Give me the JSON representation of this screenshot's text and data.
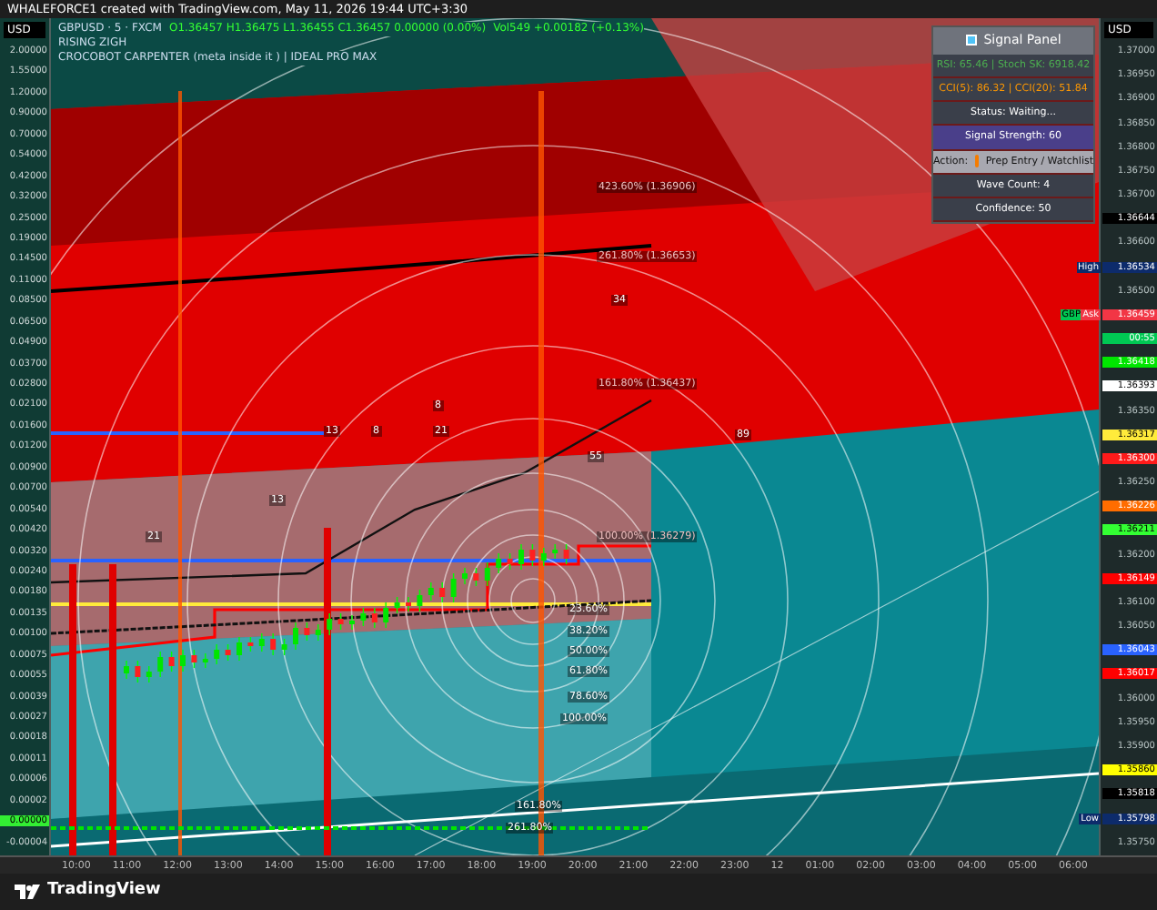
{
  "header": {
    "title": "WHALEFORCE1 created with TradingView.com, May 11, 2026 19:44 UTC+3:30"
  },
  "legend": {
    "symbol": "GBPUSD · 5 · FXCM",
    "ohlc": "O1.36457 H1.36475 L1.36455 C1.36457 0.00000 (0.00%)",
    "volume": "Vol549 +0.00182 (+0.13%)",
    "indicators": [
      "RISING ZIGH",
      "CROCOBOT CARPENTER (meta inside it ) | IDEAL PRO MAX"
    ]
  },
  "left_axis": {
    "currency": "USD",
    "labels": [
      "2.00000",
      "1.55000",
      "1.20000",
      "0.90000",
      "0.70000",
      "0.54000",
      "0.42000",
      "0.32000",
      "0.25000",
      "0.19000",
      "0.14500",
      "0.11000",
      "0.08500",
      "0.06500",
      "0.04900",
      "0.03700",
      "0.02800",
      "0.02100",
      "0.01600",
      "0.01200",
      "0.00900",
      "0.00700",
      "0.00540",
      "0.00420",
      "0.00320",
      "0.00240",
      "0.00180",
      "0.00135",
      "0.00100",
      "0.00075",
      "0.00055",
      "0.00039",
      "0.00027",
      "0.00018",
      "0.00011",
      "0.00006",
      "0.00002"
    ],
    "current": "0.00000",
    "below": [
      "-0.00004"
    ]
  },
  "right_axis": {
    "currency": "USD",
    "labels": [
      {
        "text": "1.37000"
      },
      {
        "text": "1.36950"
      },
      {
        "text": "1.36900"
      },
      {
        "text": "1.36850"
      },
      {
        "text": "1.36800"
      },
      {
        "text": "1.36750"
      },
      {
        "text": "1.36700"
      },
      {
        "text": "1.36644",
        "color": "#000000"
      },
      {
        "text": "1.36600"
      },
      {
        "text": "1.36534",
        "color": "#0d2b6b",
        "tag": "High"
      },
      {
        "text": "1.36500"
      },
      {
        "text": "1.36459",
        "color": "#f23645",
        "tag": "Ask",
        "tag2": "GBP"
      },
      {
        "text": "00:55",
        "color": "#00c853"
      },
      {
        "text": "1.36418",
        "color": "#00e600"
      },
      {
        "text": "1.36393",
        "color": "#ffffff"
      },
      {
        "text": "1.36350"
      },
      {
        "text": "1.36317",
        "color": "#ffeb3b"
      },
      {
        "text": "1.36300",
        "color": "#ff1a1a"
      },
      {
        "text": "1.36250"
      },
      {
        "text": "1.36226",
        "color": "#ff6d00"
      },
      {
        "text": "1.36211",
        "color": "#33ff33"
      },
      {
        "text": "1.36200"
      },
      {
        "text": "1.36149",
        "color": "#ff0000"
      },
      {
        "text": "1.36100"
      },
      {
        "text": "1.36050"
      },
      {
        "text": "1.36043",
        "color": "#2962ff"
      },
      {
        "text": "1.36017",
        "color": "#ff0000"
      },
      {
        "text": "1.36000"
      },
      {
        "text": "1.35950"
      },
      {
        "text": "1.35900"
      },
      {
        "text": "1.35860",
        "color": "#ffff00"
      },
      {
        "text": "1.35818",
        "color": "#000000"
      },
      {
        "text": "1.35798",
        "color": "#0d2b6b",
        "tag": "Low"
      },
      {
        "text": "1.35750"
      }
    ]
  },
  "time_axis": [
    "10:00",
    "11:00",
    "12:00",
    "13:00",
    "14:00",
    "15:00",
    "16:00",
    "17:00",
    "18:00",
    "19:00",
    "20:00",
    "21:00",
    "22:00",
    "23:00",
    "12",
    "01:00",
    "02:00",
    "03:00",
    "04:00",
    "05:00",
    "06:00"
  ],
  "chart_labels": [
    "423.60% (1.36906)",
    "261.80% (1.36653)",
    "34",
    "161.80% (1.36437)",
    "8",
    "13",
    "8",
    "21",
    "89",
    "55",
    "13",
    "21",
    "100.00% (1.36279)",
    "23.60%",
    "38.20%",
    "50.00%",
    "61.80%",
    "78.60%",
    "100.00%",
    "161.80%",
    "261.80%"
  ],
  "signal_panel": {
    "title": "Signal Panel",
    "rows": [
      {
        "kind": "metric",
        "text": "RSI: 65.46 | Stoch SK: 6918.42",
        "color": "#4caf50"
      },
      {
        "kind": "metric",
        "text": "CCI(5): 86.32 | CCI(20): 51.84",
        "color": "#ff9800"
      },
      {
        "kind": "status",
        "text": "Status: Waiting..."
      },
      {
        "kind": "strength",
        "text": "Signal Strength: 60"
      },
      {
        "kind": "action",
        "text": "Action:",
        "value": "Prep Entry / Watchlist",
        "color": "#f57c00"
      },
      {
        "kind": "info",
        "text": "Wave Count: 4"
      },
      {
        "kind": "info",
        "text": "Confidence: 50"
      }
    ]
  },
  "footer": {
    "brand": "TradingView"
  }
}
